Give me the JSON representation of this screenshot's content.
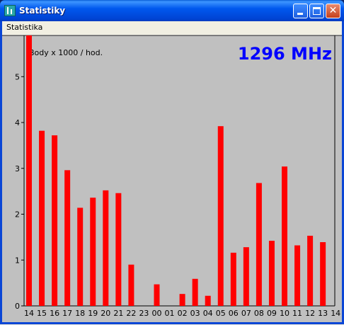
{
  "window": {
    "title": "Statistiky",
    "menu": [
      "Statistika"
    ]
  },
  "chart_data": {
    "type": "bar",
    "title": "1296 MHz",
    "annotation": "Body x 1000 / hod.",
    "categories": [
      "14",
      "15",
      "16",
      "17",
      "18",
      "19",
      "20",
      "21",
      "22",
      "23",
      "00",
      "01",
      "02",
      "03",
      "04",
      "05",
      "06",
      "07",
      "08",
      "09",
      "10",
      "11",
      "12",
      "13",
      "14"
    ],
    "values": [
      5.9,
      3.82,
      3.72,
      2.96,
      2.14,
      2.36,
      2.52,
      2.46,
      0.9,
      0,
      0.47,
      0,
      0.26,
      0.59,
      0.22,
      3.92,
      1.16,
      1.28,
      2.68,
      1.42,
      3.04,
      1.32,
      1.53,
      1.39,
      0
    ],
    "yticks": [
      "0",
      "1",
      "2",
      "3",
      "4",
      "5"
    ],
    "ylim": [
      0,
      5.9
    ],
    "grid": false,
    "colors": {
      "bar": "#ff0000",
      "title": "#0000ff",
      "background": "#c0c0c0"
    }
  }
}
